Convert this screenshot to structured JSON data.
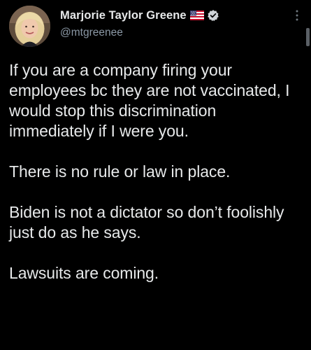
{
  "colors": {
    "background": "#000000",
    "text": "#e7e9ea",
    "secondary_text": "#8b98a5",
    "verified_badge": "#d0d4d8"
  },
  "author": {
    "display_name": "Marjorie Taylor Greene",
    "handle": "@mtgreenee",
    "flag_icon": "us-flag-icon",
    "verified_icon": "verified-badge-icon"
  },
  "more_icon": "more-vertical-icon",
  "tweet": {
    "paragraphs": [
      "If you are a company firing your employees bc they are not vaccinated, I would stop this discrimination immediately if I were you.",
      "There is no rule or law in place.",
      "Biden is not a dictator so don’t foolishly just do as he says.",
      "Lawsuits are coming."
    ]
  }
}
